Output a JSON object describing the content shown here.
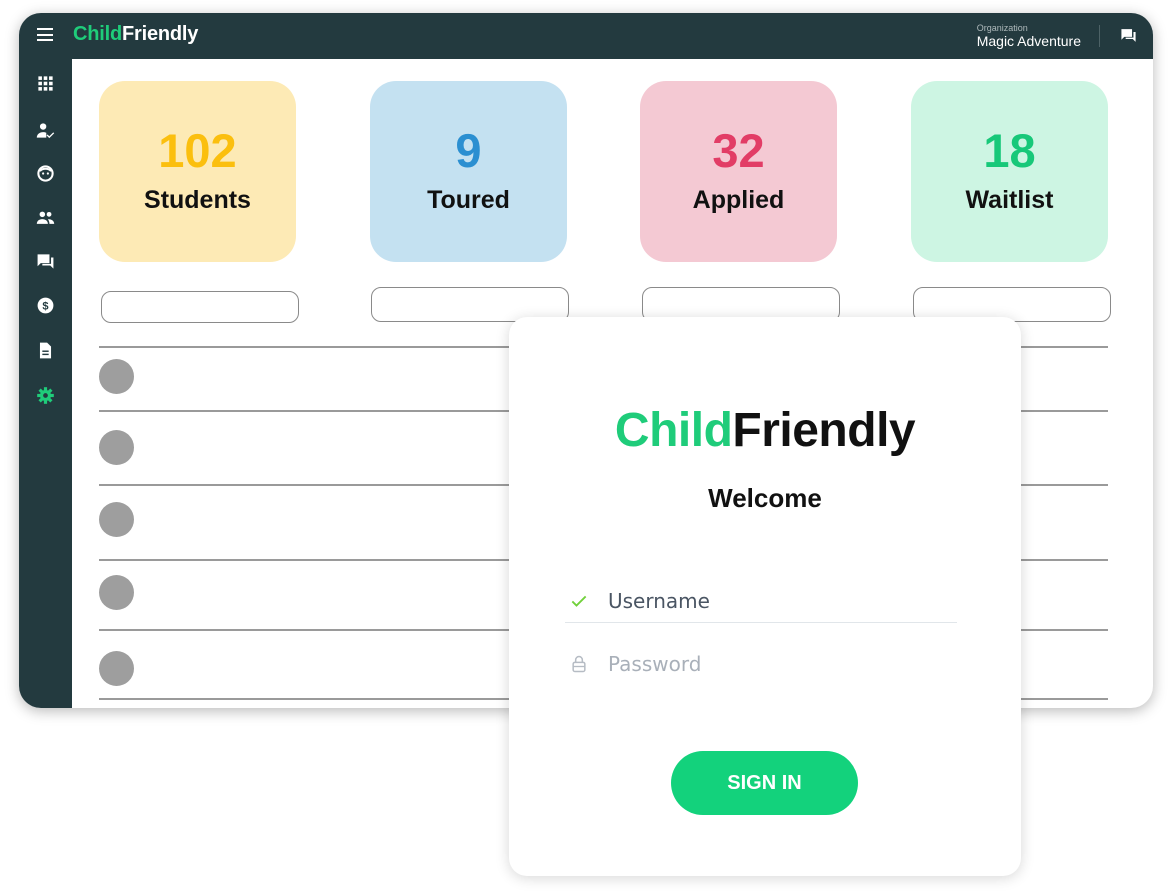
{
  "app": {
    "logo_child": "Child",
    "logo_friendly": "Friendly"
  },
  "header": {
    "org_label": "Organization",
    "org_name": "Magic Adventure"
  },
  "sidebar": {
    "items": [
      {
        "icon": "apps-grid-icon"
      },
      {
        "icon": "person-check-icon"
      },
      {
        "icon": "child-face-icon"
      },
      {
        "icon": "people-icon"
      },
      {
        "icon": "chat-icon"
      },
      {
        "icon": "dollar-icon"
      },
      {
        "icon": "document-icon"
      },
      {
        "icon": "gear-icon",
        "active": true
      }
    ]
  },
  "stats": [
    {
      "value": "102",
      "label": "Students",
      "bg": "#fdeab5",
      "color": "#fbbf0e"
    },
    {
      "value": "9",
      "label": "Toured",
      "bg": "#c4e1f1",
      "color": "#2b8fd1"
    },
    {
      "value": "32",
      "label": "Applied",
      "bg": "#f4c9d3",
      "color": "#e23d66"
    },
    {
      "value": "18",
      "label": "Waitlist",
      "bg": "#cdf5e3",
      "color": "#17c879"
    }
  ],
  "login": {
    "welcome": "Welcome",
    "username_placeholder": "Username",
    "password_placeholder": "Password",
    "signin_label": "SIGN IN"
  },
  "colors": {
    "brand_green": "#1fcc7a",
    "nav_bg": "#233a3f",
    "button_green": "#13d27c"
  }
}
